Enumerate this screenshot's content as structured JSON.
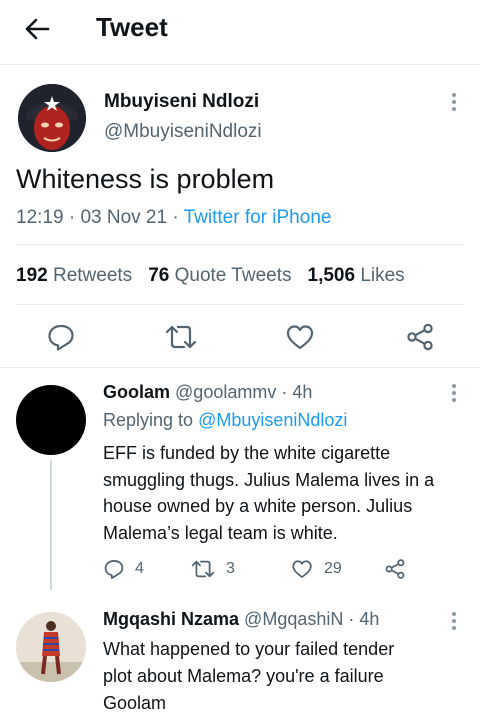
{
  "header": {
    "title": "Tweet",
    "back_icon": "arrow-left-icon"
  },
  "tweet": {
    "author_name": "Mbuyiseni Ndlozi",
    "author_handle": "@MbuyiseniNdlozi",
    "text": "Whiteness is problem",
    "time": "12:19",
    "date": "03 Nov 21",
    "sep": "·",
    "source": "Twitter for iPhone",
    "stats": {
      "retweets_count": "192",
      "retweets_label": "Retweets",
      "quotes_count": "76",
      "quotes_label": "Quote Tweets",
      "likes_count": "1,506",
      "likes_label": "Likes"
    }
  },
  "replies": [
    {
      "name": "Goolam",
      "handle": "@goolammv",
      "sep": "·",
      "age": "4h",
      "replying_prefix": "Replying to",
      "replying_to": "@MbuyiseniNdlozi",
      "text_lines": [
        "EFF is funded by the white cigarette",
        "smuggling thugs. Julius Malema lives in a",
        "house owned by a white person.  Julius",
        "Malema’s legal team is white."
      ],
      "replies_count": "4",
      "retweets_count": "3",
      "likes_count": "29"
    },
    {
      "name": "Mgqashi Nzama",
      "handle": "@MgqashiN",
      "sep": "·",
      "age": "4h",
      "text_lines": [
        "What happened to your failed tender",
        "plot about Malema? you're a failure",
        "Goolam"
      ]
    }
  ],
  "colors": {
    "accent": "#1d9bf0",
    "text": "#0f1419",
    "muted": "#536471",
    "divider": "#e6ecf0"
  }
}
